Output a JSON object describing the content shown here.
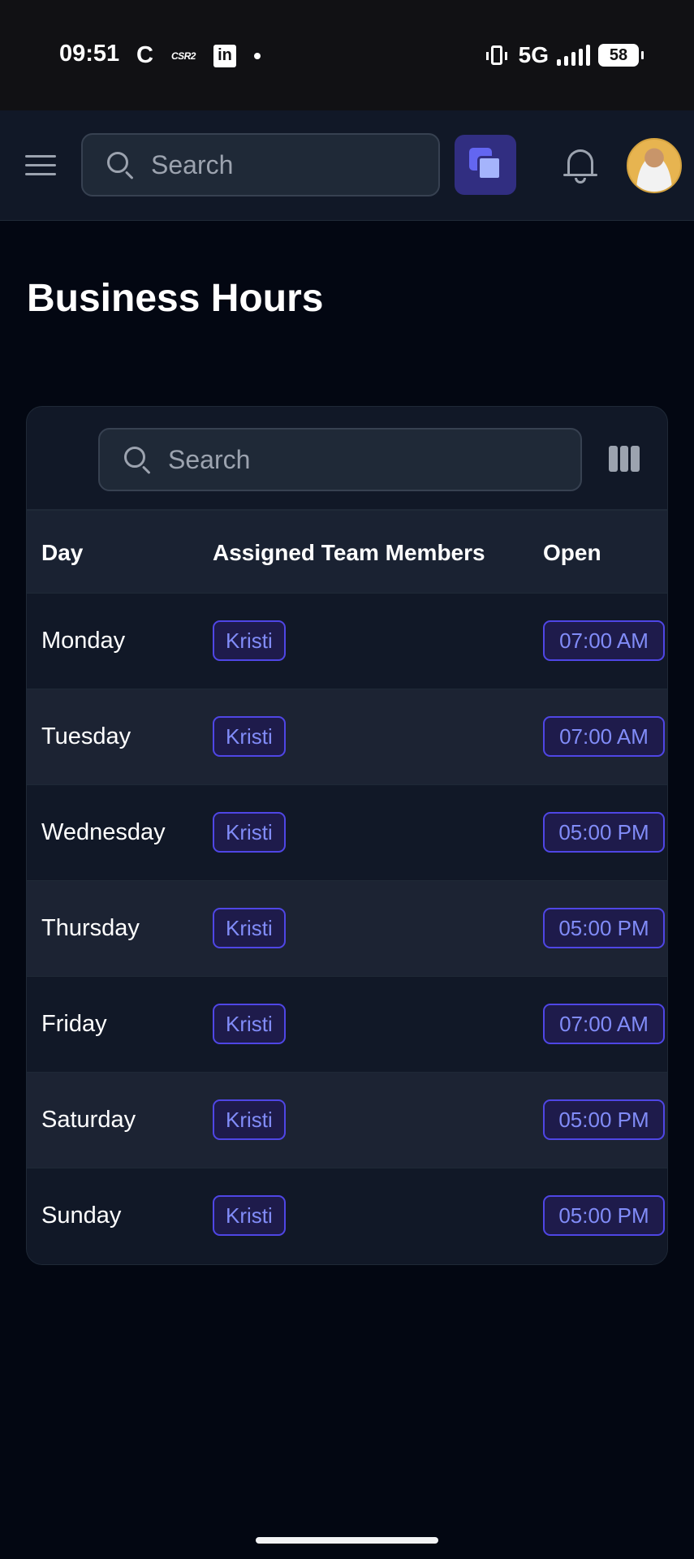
{
  "status_bar": {
    "time": "09:51",
    "app_icons": [
      "C",
      "CSR2",
      "in"
    ],
    "network": "5G",
    "battery": "58"
  },
  "header": {
    "search_placeholder": "Search",
    "icons": [
      "menu-icon",
      "apps-icon",
      "bell-icon",
      "avatar"
    ]
  },
  "page": {
    "title": "Business Hours"
  },
  "table": {
    "search_placeholder": "Search",
    "columns": [
      "Day",
      "Assigned Team Members",
      "Open"
    ],
    "rows": [
      {
        "day": "Monday",
        "member": "Kristi",
        "open": "07:00 AM"
      },
      {
        "day": "Tuesday",
        "member": "Kristi",
        "open": "07:00 AM"
      },
      {
        "day": "Wednesday",
        "member": "Kristi",
        "open": "05:00 PM"
      },
      {
        "day": "Thursday",
        "member": "Kristi",
        "open": "05:00 PM"
      },
      {
        "day": "Friday",
        "member": "Kristi",
        "open": "07:00 AM"
      },
      {
        "day": "Saturday",
        "member": "Kristi",
        "open": "05:00 PM"
      },
      {
        "day": "Sunday",
        "member": "Kristi",
        "open": "05:00 PM"
      }
    ]
  },
  "colors": {
    "background": "#030712",
    "header_bg": "#111827",
    "accent": "#818cf8",
    "badge_border": "#4f46e5"
  }
}
